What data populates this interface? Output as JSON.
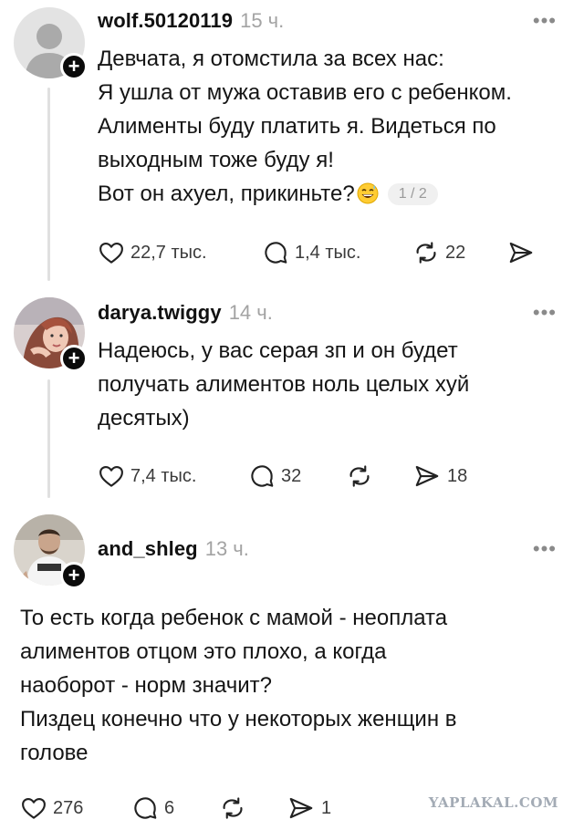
{
  "posts": [
    {
      "username": "wolf.50120119",
      "time": "15 ч.",
      "more": "•••",
      "text": "Девчата, я отомстила за всех нас:\nЯ ушла от мужа оставив его с ребенком.\nАлименты буду платить я. Видеться по\nвыходным тоже буду я!\nВот он ахуел, прикиньте?",
      "emoji_icon": "grinning-sweat-emoji-icon",
      "pager": "1 / 2",
      "likes": "22,7 тыс.",
      "comments": "1,4 тыс.",
      "reposts": "22",
      "shares": ""
    },
    {
      "username": "darya.twiggy",
      "time": "14 ч.",
      "more": "•••",
      "text": "Надеюсь, у вас серая зп и он будет\nполучать алиментов ноль целых хуй\nдесятых)",
      "likes": "7,4 тыс.",
      "comments": "32",
      "reposts": "",
      "shares": "18"
    },
    {
      "username": "and_shleg",
      "time": "13 ч.",
      "more": "•••",
      "text": "То есть когда ребенок с мамой - неоплата\nалиментов отцом это плохо, а когда\nнаоборот - норм значит?\nПиздец конечно что у некоторых женщин в\nголове",
      "likes": "276",
      "comments": "6",
      "reposts": "",
      "shares": "1"
    }
  ],
  "follow_symbol": "+",
  "watermark": "YAPLAKAL.COM",
  "colors": {
    "follow_badge": "#0b0b0b",
    "time": "#a3a3a3",
    "thread_line": "#e0e0e0",
    "watermark": "#a3abb5"
  }
}
